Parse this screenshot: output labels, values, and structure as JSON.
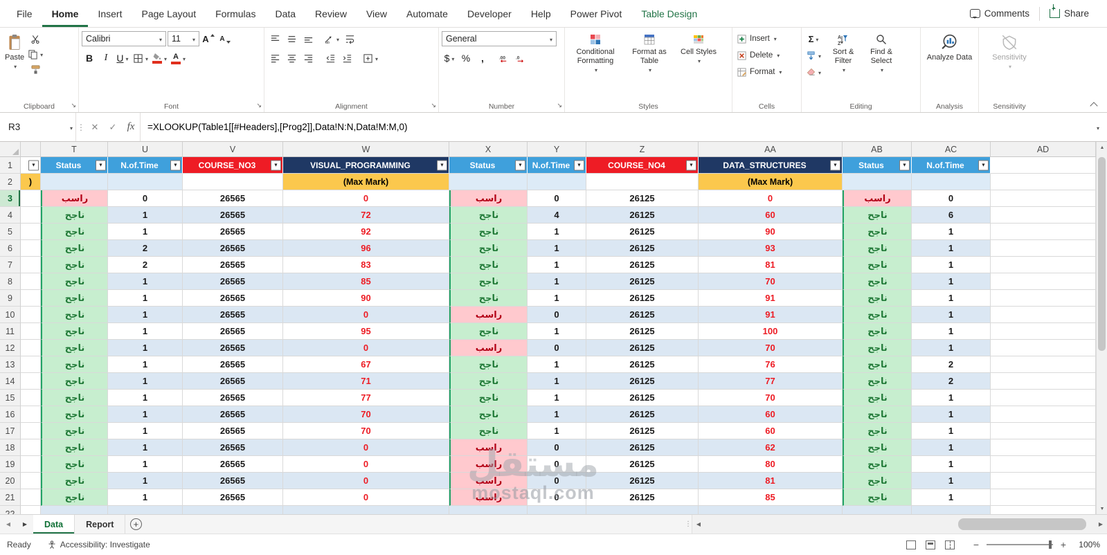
{
  "app": {
    "tabs": [
      {
        "label": "File"
      },
      {
        "label": "Home",
        "active": true
      },
      {
        "label": "Insert"
      },
      {
        "label": "Page Layout"
      },
      {
        "label": "Formulas"
      },
      {
        "label": "Data"
      },
      {
        "label": "Review"
      },
      {
        "label": "View"
      },
      {
        "label": "Automate"
      },
      {
        "label": "Developer"
      },
      {
        "label": "Help"
      },
      {
        "label": "Power Pivot"
      },
      {
        "label": "Table Design",
        "contextual": true
      }
    ],
    "comments_label": "Comments",
    "share_label": "Share"
  },
  "ribbon": {
    "clipboard": {
      "label": "Clipboard",
      "paste": "Paste"
    },
    "font": {
      "label": "Font",
      "font_name": "Calibri",
      "font_size": "11",
      "bold": "B",
      "italic": "I",
      "underline": "U"
    },
    "alignment": {
      "label": "Alignment"
    },
    "number": {
      "label": "Number",
      "format": "General",
      "currency": "$",
      "percent": "%",
      "comma": ","
    },
    "styles": {
      "label": "Styles",
      "conditional_formatting": "Conditional Formatting",
      "format_as_table": "Format as Table",
      "cell_styles": "Cell Styles"
    },
    "cells": {
      "label": "Cells",
      "insert": "Insert",
      "delete": "Delete",
      "format": "Format"
    },
    "editing": {
      "label": "Editing",
      "autosum": "Σ",
      "sort_filter": "Sort & Filter",
      "find_select": "Find & Select"
    },
    "analysis": {
      "label": "Analysis",
      "analyze_data": "Analyze Data"
    },
    "sensitivity": {
      "label": "Sensitivity",
      "sensitivity": "Sensitivity"
    }
  },
  "formula_bar": {
    "name_box": "R3",
    "fx": "fx",
    "formula": "=XLOOKUP(Table1[[#Headers],[Prog2]],Data!N:N,Data!M:M,0)"
  },
  "grid": {
    "column_letters": [
      "",
      "T",
      "U",
      "V",
      "W",
      "X",
      "Y",
      "Z",
      "AA",
      "AB",
      "AC",
      "AD"
    ],
    "header_labels": [
      "Status",
      "N.of.Time",
      "COURSE_NO3",
      "VISUAL_PROGRAMMING",
      "Status",
      "N.of.Time",
      "COURSE_NO4",
      "DATA_STRUCTURES",
      "Status",
      "N.of.Time"
    ],
    "header_styles": [
      "blue",
      "blue",
      "red",
      "navy",
      "blue",
      "blue",
      "red",
      "navy",
      "blue",
      "blue"
    ],
    "max_mark_label": "(Max Mark)",
    "row2_partial_text": ")",
    "pass_text": "ناجح",
    "fail_text": "راسب",
    "selected_row": "3",
    "rows": [
      {
        "n": "3",
        "v": [
          "راسب",
          "0",
          "26565",
          "0",
          "راسب",
          "0",
          "26125",
          "0",
          "راسب",
          "0"
        ]
      },
      {
        "n": "4",
        "v": [
          "ناجح",
          "1",
          "26565",
          "72",
          "ناجح",
          "4",
          "26125",
          "60",
          "ناجح",
          "6"
        ]
      },
      {
        "n": "5",
        "v": [
          "ناجح",
          "1",
          "26565",
          "92",
          "ناجح",
          "1",
          "26125",
          "90",
          "ناجح",
          "1"
        ]
      },
      {
        "n": "6",
        "v": [
          "ناجح",
          "2",
          "26565",
          "96",
          "ناجح",
          "1",
          "26125",
          "93",
          "ناجح",
          "1"
        ]
      },
      {
        "n": "7",
        "v": [
          "ناجح",
          "2",
          "26565",
          "83",
          "ناجح",
          "1",
          "26125",
          "81",
          "ناجح",
          "1"
        ]
      },
      {
        "n": "8",
        "v": [
          "ناجح",
          "1",
          "26565",
          "85",
          "ناجح",
          "1",
          "26125",
          "70",
          "ناجح",
          "1"
        ]
      },
      {
        "n": "9",
        "v": [
          "ناجح",
          "1",
          "26565",
          "90",
          "ناجح",
          "1",
          "26125",
          "91",
          "ناجح",
          "1"
        ]
      },
      {
        "n": "10",
        "v": [
          "ناجح",
          "1",
          "26565",
          "0",
          "راسب",
          "0",
          "26125",
          "91",
          "ناجح",
          "1"
        ]
      },
      {
        "n": "11",
        "v": [
          "ناجح",
          "1",
          "26565",
          "95",
          "ناجح",
          "1",
          "26125",
          "100",
          "ناجح",
          "1"
        ]
      },
      {
        "n": "12",
        "v": [
          "ناجح",
          "1",
          "26565",
          "0",
          "راسب",
          "0",
          "26125",
          "70",
          "ناجح",
          "1"
        ]
      },
      {
        "n": "13",
        "v": [
          "ناجح",
          "1",
          "26565",
          "67",
          "ناجح",
          "1",
          "26125",
          "76",
          "ناجح",
          "2"
        ]
      },
      {
        "n": "14",
        "v": [
          "ناجح",
          "1",
          "26565",
          "71",
          "ناجح",
          "1",
          "26125",
          "77",
          "ناجح",
          "2"
        ]
      },
      {
        "n": "15",
        "v": [
          "ناجح",
          "1",
          "26565",
          "77",
          "ناجح",
          "1",
          "26125",
          "70",
          "ناجح",
          "1"
        ]
      },
      {
        "n": "16",
        "v": [
          "ناجح",
          "1",
          "26565",
          "70",
          "ناجح",
          "1",
          "26125",
          "60",
          "ناجح",
          "1"
        ]
      },
      {
        "n": "17",
        "v": [
          "ناجح",
          "1",
          "26565",
          "70",
          "ناجح",
          "1",
          "26125",
          "60",
          "ناجح",
          "1"
        ]
      },
      {
        "n": "18",
        "v": [
          "ناجح",
          "1",
          "26565",
          "0",
          "راسب",
          "0",
          "26125",
          "62",
          "ناجح",
          "1"
        ]
      },
      {
        "n": "19",
        "v": [
          "ناجح",
          "1",
          "26565",
          "0",
          "راسب",
          "0",
          "26125",
          "80",
          "ناجح",
          "1"
        ]
      },
      {
        "n": "20",
        "v": [
          "ناجح",
          "1",
          "26565",
          "0",
          "راسب",
          "0",
          "26125",
          "81",
          "ناجح",
          "1"
        ]
      },
      {
        "n": "21",
        "v": [
          "ناجح",
          "1",
          "26565",
          "0",
          "راسب",
          "0",
          "26125",
          "85",
          "ناجح",
          "1"
        ]
      }
    ]
  },
  "sheet_bar": {
    "tabs": [
      {
        "label": "Data",
        "active": true
      },
      {
        "label": "Report"
      }
    ]
  },
  "status_bar": {
    "ready": "Ready",
    "accessibility": "Accessibility: Investigate",
    "zoom": "100%"
  },
  "watermark": {
    "line1": "مستقل",
    "line2": "mostaql.com"
  },
  "colors": {
    "excel_green": "#217346",
    "header_blue": "#3FA0DC",
    "header_red": "#EE1C25",
    "header_navy": "#1F3864",
    "max_mark_yellow": "#FBC84D",
    "band_blue": "#DBE7F3",
    "row2_blue": "#DDEBF7",
    "pass_bg": "#C7EECF",
    "pass_text": "#217A38",
    "fail_bg": "#FFC9CE",
    "fail_text": "#B30016",
    "mark_red": "#ED1C24",
    "table_green_border": "#21A366",
    "selected_row_bg": "#CDE9D3",
    "selected_row_text": "#0E6F35"
  }
}
